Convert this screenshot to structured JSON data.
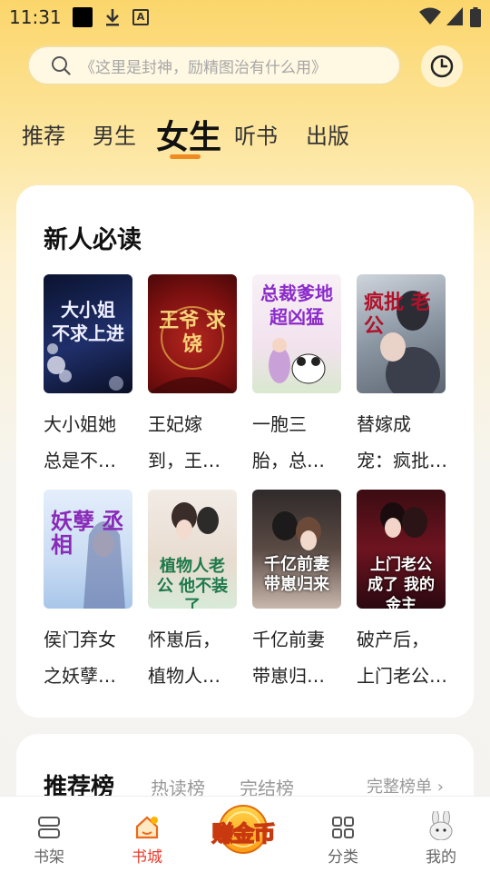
{
  "status_bar": {
    "time": "11:31",
    "a_icon": "A"
  },
  "search": {
    "placeholder": "《这里是封神，励精图治有什么用》"
  },
  "tabs": [
    {
      "label": "推荐",
      "active": false
    },
    {
      "label": "男生",
      "active": false
    },
    {
      "label": "女生",
      "active": true
    },
    {
      "label": "听书",
      "active": false
    },
    {
      "label": "出版",
      "active": false
    }
  ],
  "section": {
    "title": "新人必读",
    "books": [
      {
        "title": "大小姐她\n总是不…",
        "cover_text": "大小姐\n不求上进"
      },
      {
        "title": "王妃嫁\n到，王…",
        "cover_text": "王爷\n求饶"
      },
      {
        "title": "一胞三\n胎，总…",
        "cover_text": "总裁爹地\n超凶猛"
      },
      {
        "title": "替嫁成\n宠：疯批…",
        "cover_text": "疯批\n老公"
      },
      {
        "title": "侯门弃女\n之妖孽…",
        "cover_text": "妖孽\n丞相"
      },
      {
        "title": "怀崽后，\n植物人…",
        "cover_text": "植物人老公\n他不装了"
      },
      {
        "title": "千亿前妻\n带崽归…",
        "cover_text": "千亿前妻\n带崽归来"
      },
      {
        "title": "破产后，\n上门老公…",
        "cover_text": "上门老公成了\n我的金主"
      }
    ]
  },
  "ranking": {
    "title": "推荐榜",
    "tabs": [
      "热读榜",
      "完结榜"
    ],
    "more": "完整榜单 ›"
  },
  "bottom_nav": {
    "items": [
      {
        "label": "书架",
        "icon": "bookshelf-icon",
        "active": false
      },
      {
        "label": "书城",
        "icon": "bookstore-icon",
        "active": true
      },
      {
        "label": "分类",
        "icon": "category-grid-icon",
        "active": false
      },
      {
        "label": "我的",
        "icon": "rabbit-avatar-icon",
        "active": false
      }
    ],
    "earn_label": "赚金币"
  },
  "colors": {
    "accent": "#f08a22",
    "active_nav": "#ea3d2e",
    "brand_yellow": "#fbd66b"
  }
}
